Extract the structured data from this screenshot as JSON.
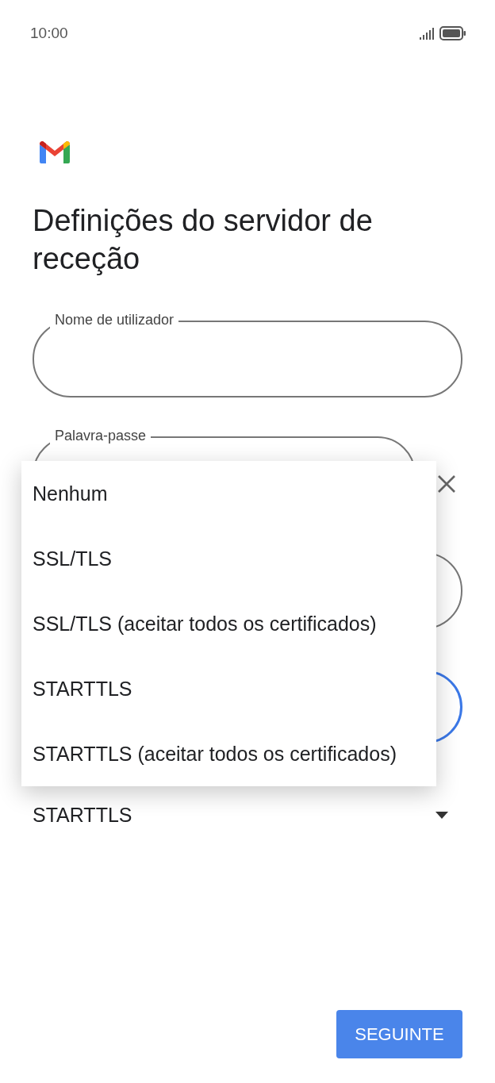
{
  "status_bar": {
    "time": "10:00"
  },
  "title": "Definições do servidor de receção",
  "fields": [
    {
      "kind": "text",
      "label": "Nome de utilizador",
      "focused": false
    },
    {
      "kind": "password",
      "label": "Palavra-passe",
      "focused": false
    },
    {
      "kind": "text",
      "focused": false
    },
    {
      "kind": "text",
      "focused": true
    }
  ],
  "security": {
    "value": "STARTTLS"
  },
  "menu": {
    "options": [
      "Nenhum",
      "SSL/TLS",
      "SSL/TLS (aceitar todos os certificados)",
      "STARTTLS",
      "STARTTLS (aceitar todos os certificados)"
    ]
  },
  "button": "SEGUINTE"
}
